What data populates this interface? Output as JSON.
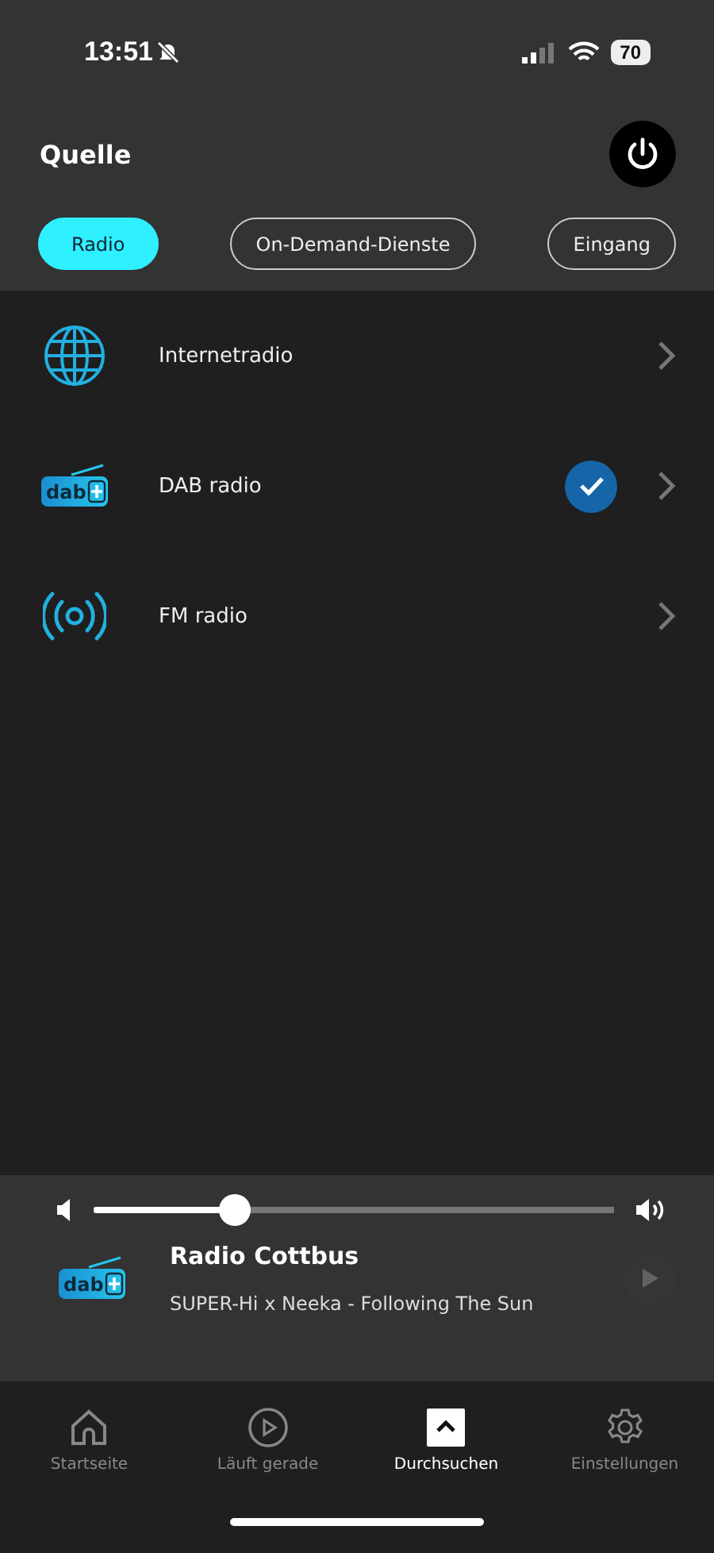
{
  "status_bar": {
    "time": "13:51",
    "battery": "70"
  },
  "header": {
    "title": "Quelle"
  },
  "tabs": [
    {
      "label": "Radio",
      "selected": true
    },
    {
      "label": "On-Demand-Dienste",
      "selected": false
    },
    {
      "label": "Eingang",
      "selected": false
    }
  ],
  "sources": [
    {
      "kind": "globe",
      "label": "Internetradio",
      "selected": false
    },
    {
      "kind": "dab",
      "logo_text": "dab",
      "label": "DAB radio",
      "selected": true
    },
    {
      "kind": "fm",
      "label": "FM radio",
      "selected": false
    }
  ],
  "volume": {
    "level": 0.27
  },
  "now_playing": {
    "logo_text": "dab",
    "station": "Radio Cottbus",
    "track": "SUPER-Hi x Neeka - Following The Sun",
    "play_disabled": true
  },
  "nav": [
    {
      "kind": "home",
      "label": "Startseite",
      "selected": false
    },
    {
      "kind": "play",
      "label": "Läuft gerade",
      "selected": false
    },
    {
      "kind": "browse",
      "label": "Durchsuchen",
      "selected": true
    },
    {
      "kind": "settings",
      "label": "Einstellungen",
      "selected": false
    }
  ]
}
